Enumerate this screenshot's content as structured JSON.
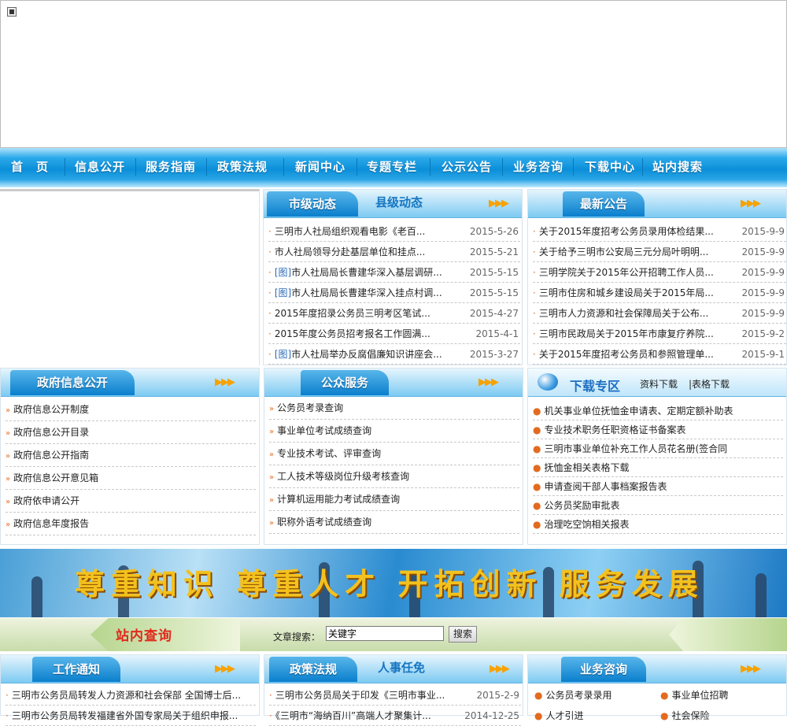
{
  "nav": [
    "首　页",
    "信息公开",
    "服务指南",
    "政策法规",
    "新闻中心",
    "专题专栏",
    "公示公告",
    "业务咨询",
    "下载中心",
    "站内搜索"
  ],
  "city_news": {
    "tab1": "市级动态",
    "tab2": "县级动态",
    "items": [
      {
        "img": "",
        "title": "三明市人社局组织观看电影《老百...",
        "date": "2015-5-26"
      },
      {
        "img": "",
        "title": "市人社局领导分赴基层单位和挂点...",
        "date": "2015-5-21"
      },
      {
        "img": "[图]",
        "title": "市人社局局长曹建华深入基层调研...",
        "date": "2015-5-15"
      },
      {
        "img": "[图]",
        "title": "市人社局局长曹建华深入挂点村调...",
        "date": "2015-5-15"
      },
      {
        "img": "",
        "title": "2015年度招录公务员三明考区笔试...",
        "date": "2015-4-27"
      },
      {
        "img": "",
        "title": "2015年度公务员招考报名工作圆满...",
        "date": "2015-4-1"
      },
      {
        "img": "[图]",
        "title": "市人社局举办反腐倡廉知识讲座会...",
        "date": "2015-3-27"
      }
    ]
  },
  "notices": {
    "tab": "最新公告",
    "items": [
      {
        "title": "关于2015年度招考公务员录用体检结果...",
        "date": "2015-9-9"
      },
      {
        "title": "关于给予三明市公安局三元分局叶明明...",
        "date": "2015-9-9"
      },
      {
        "title": "三明学院关于2015年公开招聘工作人员...",
        "date": "2015-9-9"
      },
      {
        "title": "三明市住房和城乡建设局关于2015年局...",
        "date": "2015-9-9"
      },
      {
        "title": "三明市人力资源和社会保障局关于公布...",
        "date": "2015-9-9"
      },
      {
        "title": "三明市民政局关于2015年市康复疗养院...",
        "date": "2015-9-2"
      },
      {
        "title": "关于2015年度招考公务员和参照管理单...",
        "date": "2015-9-1"
      }
    ]
  },
  "gov_info": {
    "tab": "政府信息公开",
    "items": [
      "政府信息公开制度",
      "政府信息公开目录",
      "政府信息公开指南",
      "政府信息公开意见箱",
      "政府依申请公开",
      "政府信息年度报告"
    ]
  },
  "public_service": {
    "tab": "公众服务",
    "items": [
      "公务员考录查询",
      "事业单位考试成绩查询",
      "专业技术考试、评审查询",
      "工人技术等级岗位升级考核查询",
      "计算机运用能力考试成绩查询",
      "职称外语考试成绩查询"
    ]
  },
  "download": {
    "title": "下载专区",
    "link1": "资料下载",
    "link2": "|表格下载",
    "items": [
      "机关事业单位抚恤金申请表、定期定额补助表",
      "专业技术职务任职资格证书备案表",
      "三明市事业单位补充工作人员花名册(签合同",
      "抚恤金相关表格下载",
      "申请查阅干部人事档案报告表",
      "公务员奖励审批表",
      "治理吃空饷相关报表"
    ]
  },
  "motto": "尊重知识 尊重人才 开拓创新 服务发展",
  "search": {
    "title": "站内查询",
    "label": "文章搜索：",
    "value": "关键字",
    "button": "搜索"
  },
  "work_notice": {
    "tab": "工作通知",
    "items": [
      "三明市公务员局转发人力资源和社会保部 全国博士后...",
      "三明市公务员局转发福建省外国专家局关于组织申报..."
    ]
  },
  "policy": {
    "tab1": "政策法规",
    "tab2": "人事任免",
    "items": [
      {
        "title": "三明市公务员局关于印发《三明市事业...",
        "date": "2015-2-9"
      },
      {
        "title": "《三明市“海纳百川”高端人才聚集计...",
        "date": "2014-12-25"
      }
    ]
  },
  "consult": {
    "tab": "业务咨询",
    "items": [
      "公务员考录录用",
      "事业单位招聘",
      "人才引进",
      "社会保险"
    ]
  },
  "colors": {
    "nav": "#0b8fd9",
    "tab": "#0a7fcd",
    "arrow": "#f7a200",
    "search_title": "#e0291b"
  }
}
